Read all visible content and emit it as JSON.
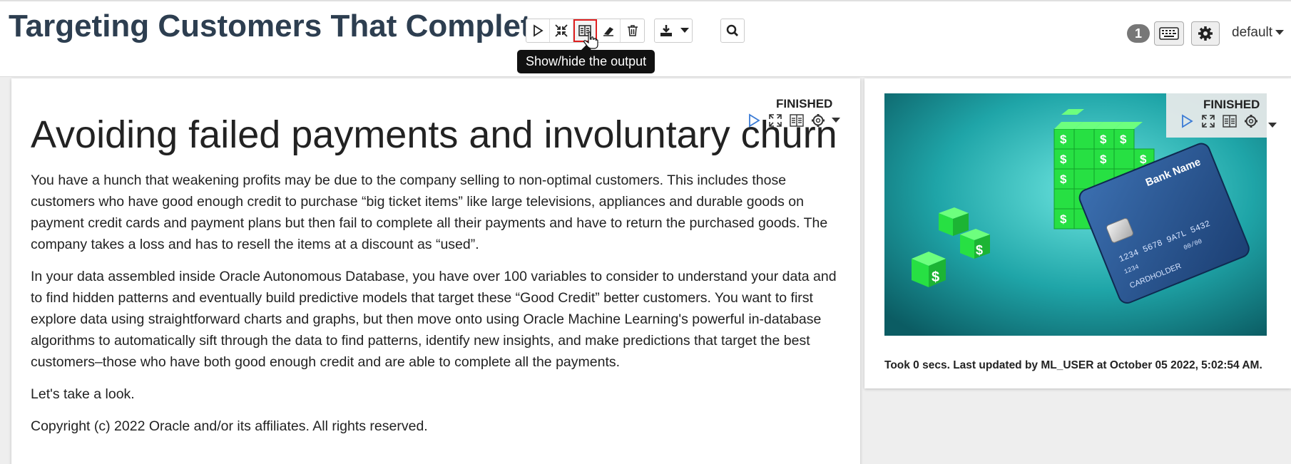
{
  "notebook": {
    "title": "Targeting Customers That Complete",
    "notification_count": "1",
    "interpreter_label": "default"
  },
  "toolbar": {
    "buttons": [
      {
        "name": "run-all-button",
        "icon": "play-icon"
      },
      {
        "name": "collapse-all-button",
        "icon": "compress-icon"
      },
      {
        "name": "show-hide-output-button",
        "icon": "book-icon"
      },
      {
        "name": "clear-output-button",
        "icon": "eraser-icon"
      },
      {
        "name": "delete-button",
        "icon": "trash-icon"
      },
      {
        "name": "export-button",
        "icon": "download-icon"
      },
      {
        "name": "search-button",
        "icon": "search-icon"
      }
    ],
    "tooltip": "Show/hide the output"
  },
  "paragraph_left": {
    "status": "FINISHED",
    "heading": "Avoiding failed payments and involuntary churn",
    "paragraphs": [
      "You have a hunch that weakening profits may be due to the company selling to non-optimal customers. This includes those customers who have good enough credit to purchase “big ticket items” like large televisions, appliances and durable goods on payment credit cards and payment plans but then fail to complete all their payments and have to return the purchased goods. The company takes a loss and has to resell the items at a discount as “used”.",
      "In your data assembled inside Oracle Autonomous Database, you have over 100 variables to consider to understand your data and to find hidden patterns and eventually build predictive models that target these “Good Credit” better customers. You want to first explore data using straightforward charts and graphs, but then move onto using Oracle Machine Learning's powerful in-database algorithms to automatically sift through the data to find patterns, identify new insights, and make predictions that target the best customers–those who have both good enough credit and are able to complete all the payments.",
      "Let's take a look.",
      "Copyright (c) 2022 Oracle and/or its affiliates. All rights reserved."
    ]
  },
  "paragraph_right": {
    "status": "FINISHED",
    "card_text": {
      "bank_name": "Bank Name",
      "number": "1234 5678 9A7L 5432",
      "small": "1234",
      "valid": "00/00",
      "holder": "CARDHOLDER"
    },
    "footer": "Took 0 secs. Last updated by ML_USER at October 05 2022, 5:02:54 AM."
  },
  "colors": {
    "title": "#2d3e50",
    "play_blue": "#3a7bd5",
    "active_outline": "#e02020",
    "cube_green": "#22dd44"
  }
}
